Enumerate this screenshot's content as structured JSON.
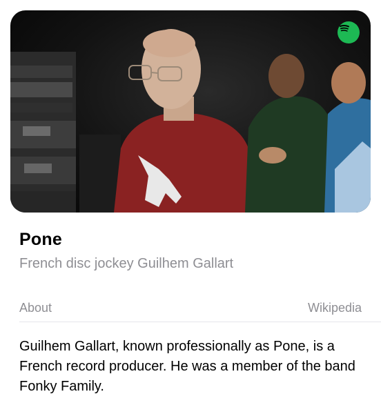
{
  "card": {
    "image_alt": "Photo of Pone",
    "source_icon": "spotify-icon",
    "title": "Pone",
    "subtitle": "French disc jockey Guilhem Gallart"
  },
  "about": {
    "label": "About",
    "source_link": "Wikipedia",
    "text": "Guilhem Gallart, known professionally as Pone, is a French record producer. He was a member of the band Fonky Family."
  },
  "colors": {
    "spotify_green": "#1db954",
    "secondary_text": "#8e8e93",
    "divider": "#e5e5ea"
  }
}
